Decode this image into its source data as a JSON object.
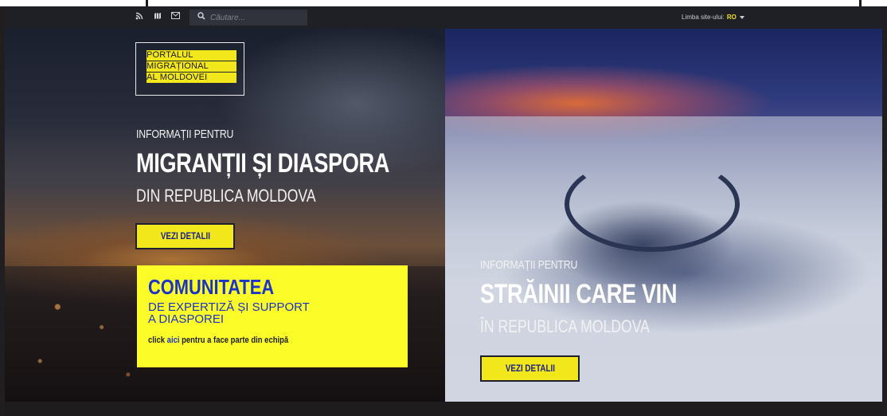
{
  "header": {
    "search_placeholder": "Căutare...",
    "language_label": "Limba site-ului:",
    "language_code": "RO"
  },
  "logo": {
    "lines": [
      "PORTALUL",
      "MIGRAȚIONAL",
      "AL MOLDOVEI"
    ]
  },
  "left": {
    "subtitle": "INFORMAȚII PENTRU",
    "title": "MIGRANȚII ȘI DIASPORA",
    "tagline": "DIN REPUBLICA MOLDOVA",
    "button_label": "VEZI DETALII"
  },
  "community": {
    "title": "COMUNITATEA",
    "line1": "DE EXPERTIZĂ ȘI SUPPORT",
    "line2": "A DIASPOREI",
    "click_prefix": "click ",
    "click_link": "aici",
    "click_suffix": " pentru a face parte din echipă"
  },
  "right": {
    "subtitle": "INFORMAȚII PENTRU",
    "title": "STRĂINII CARE VIN",
    "tagline": "ÎN REPUBLICA MOLDOVA",
    "button_label": "VEZI DETALII"
  },
  "colors": {
    "accent_yellow": "#f2e71a",
    "community_bg": "#fcfc28",
    "community_text": "#1b33c7",
    "button_text": "#1c2287"
  },
  "icons": [
    "rss-icon",
    "map-icon",
    "mail-icon",
    "search-icon",
    "caret-down-icon"
  ]
}
